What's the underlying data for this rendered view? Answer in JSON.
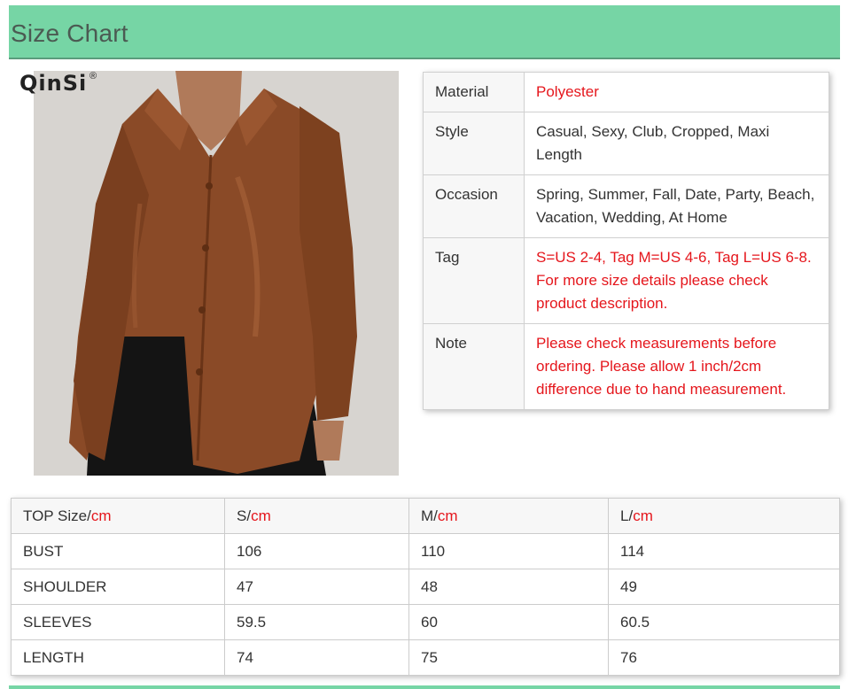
{
  "header": {
    "title": "Size Chart"
  },
  "brand": {
    "logo_text": "QinSi",
    "registered_mark": "®"
  },
  "colors": {
    "accent_green": "#76d5a5",
    "highlight_red": "#e5161c",
    "product_brown": "#8a4a27"
  },
  "product_image": {
    "alt": "product-photo"
  },
  "info": [
    {
      "label": "Material",
      "value": "Polyester",
      "value_color": "red",
      "lines": [
        "Polyester"
      ]
    },
    {
      "label": "Style",
      "value_color": "normal",
      "lines": [
        "Casual, Sexy, Club, Cropped, Maxi Length"
      ]
    },
    {
      "label": "Occasion",
      "value_color": "normal",
      "lines": [
        "Spring, Summer, Fall, Date, Party, Beach,",
        "Vacation, Wedding, At Home"
      ]
    },
    {
      "label": "Tag",
      "value_color": "red",
      "lines": [
        "S=US 2-4, Tag M=US 4-6, Tag L=US 6-8.",
        "For more size details please check",
        "product description."
      ]
    },
    {
      "label": "Note",
      "value_color": "red",
      "lines": [
        "Please check measurements before",
        "ordering. Please allow 1 inch/2cm",
        "difference due to hand measurement."
      ]
    }
  ],
  "size_table": {
    "headers": [
      {
        "label": "TOP Size/",
        "unit": "cm"
      },
      {
        "label": "S/",
        "unit": "cm"
      },
      {
        "label": "M/",
        "unit": "cm"
      },
      {
        "label": "L/",
        "unit": "cm"
      }
    ],
    "rows": [
      {
        "name": "BUST",
        "s": "106",
        "m": "110",
        "l": "114"
      },
      {
        "name": "SHOULDER",
        "s": "47",
        "m": "48",
        "l": "49"
      },
      {
        "name": "SLEEVES",
        "s": "59.5",
        "m": "60",
        "l": "60.5"
      },
      {
        "name": "LENGTH",
        "s": "74",
        "m": "75",
        "l": "76"
      }
    ]
  }
}
